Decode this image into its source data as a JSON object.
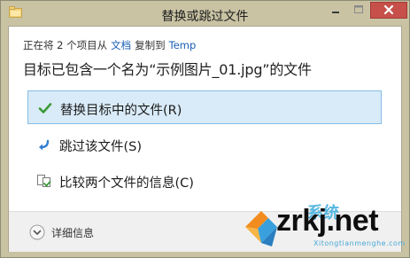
{
  "window": {
    "title": "替换或跳过文件",
    "controls": {
      "minimize": "minimize-icon",
      "maximize": "maximize-icon",
      "close": "close-icon"
    }
  },
  "status": {
    "prefix": "正在将 2 个项目从",
    "source": "文档",
    "middle": "复制到",
    "destination": "Temp"
  },
  "headline": "目标已包含一个名为“示例图片_01.jpg”的文件",
  "options": [
    {
      "label": "替换目标中的文件(R)",
      "icon": "checkmark-icon",
      "selected": true
    },
    {
      "label": "跳过该文件(S)",
      "icon": "skip-arrow-icon",
      "selected": false
    },
    {
      "label": "比较两个文件的信息(C)",
      "icon": "compare-files-icon",
      "selected": false
    }
  ],
  "footer": {
    "details_label": "详细信息",
    "details_icon": "chevron-down-icon"
  },
  "watermark": {
    "text": "zrkj.net",
    "top_text": "系统",
    "sub_text": "Xitongtianmenghe.com"
  },
  "colors": {
    "titlebar": "#c9c3a4",
    "close_button": "#c7504a",
    "selected_bg": "#d9ebf9",
    "selected_border": "#86bde6",
    "link": "#1a5fb4"
  }
}
